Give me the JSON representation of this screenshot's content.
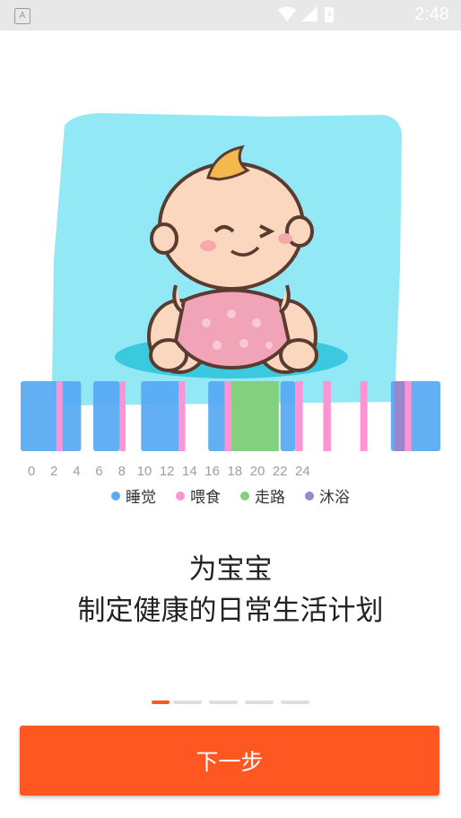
{
  "status_bar": {
    "time": "2:48",
    "notification_letter": "A"
  },
  "timeline": {
    "axis_labels": [
      "0",
      "2",
      "4",
      "6",
      "8",
      "10",
      "12",
      "14",
      "16",
      "18",
      "20",
      "22",
      "24"
    ],
    "colors": {
      "sleep": "#5aabf3",
      "feed": "#ff93d4",
      "walk": "#83d07e",
      "bath": "#9a86ce"
    },
    "activities": [
      {
        "type": "sleep",
        "start": 0,
        "end": 14.4
      },
      {
        "type": "sleep",
        "start": 17.3,
        "end": 23.6
      },
      {
        "type": "sleep",
        "start": 28.7,
        "end": 39.2
      },
      {
        "type": "sleep",
        "start": 44.7,
        "end": 49.3
      },
      {
        "type": "sleep",
        "start": 55.4,
        "end": 58.3
      },
      {
        "type": "sleep",
        "start": 61.9,
        "end": 65.4
      },
      {
        "type": "sleep",
        "start": 88.2,
        "end": 100
      },
      {
        "type": "feed",
        "start": 8.5,
        "end": 10.0
      },
      {
        "type": "feed",
        "start": 23.6,
        "end": 25.0
      },
      {
        "type": "feed",
        "start": 37.6,
        "end": 39.2
      },
      {
        "type": "feed",
        "start": 48.6,
        "end": 50.2
      },
      {
        "type": "feed",
        "start": 65.4,
        "end": 67.2
      },
      {
        "type": "feed",
        "start": 72.1,
        "end": 73.9
      },
      {
        "type": "feed",
        "start": 80.9,
        "end": 82.6
      },
      {
        "type": "feed",
        "start": 91.5,
        "end": 93.1
      },
      {
        "type": "walk",
        "start": 50.2,
        "end": 61.5
      },
      {
        "type": "bath",
        "start": 89.0,
        "end": 91.5
      }
    ]
  },
  "legend": [
    {
      "label": "睡觉",
      "color": "#5aabf3"
    },
    {
      "label": "喂食",
      "color": "#ff93d4"
    },
    {
      "label": "走路",
      "color": "#83d07e"
    },
    {
      "label": "沐浴",
      "color": "#9a86ce"
    }
  ],
  "headline": {
    "line1": "为宝宝",
    "line2": "制定健康的日常生活计划"
  },
  "pager": {
    "count": 5,
    "active": 0
  },
  "next_button": {
    "label": "下一步"
  }
}
